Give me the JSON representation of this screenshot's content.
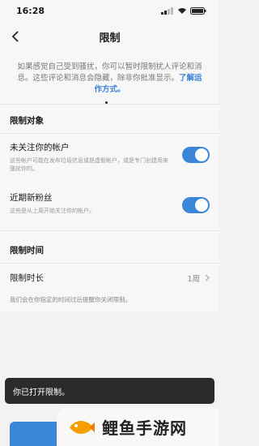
{
  "status_bar": {
    "time": "16:28"
  },
  "nav": {
    "title": "限制"
  },
  "intro": {
    "text": "如果感觉自己受到骚扰，你可以暂时限制扰人评论和消息。这些评论和消息会隐藏，除非你批准显示。",
    "link": "了解运作方式。"
  },
  "restrict_target": {
    "title": "限制对象",
    "items": [
      {
        "title": "未关注你的帐户",
        "desc": "这些帐户可能在发布垃圾信息或是虚假帐户，或是专门创建用来骚扰你的。",
        "enabled": true
      },
      {
        "title": "近期新粉丝",
        "desc": "这些是从上周开始关注你的帐户。",
        "enabled": true
      }
    ]
  },
  "restrict_time": {
    "title": "限制时间",
    "label": "限制时长",
    "value": "1周",
    "note": "我们会在你指定的时间过后提醒你关闭限制。"
  },
  "toast": {
    "text": "你已打开限制。"
  },
  "watermark": {
    "text": "鲤鱼手游网"
  },
  "colors": {
    "accent": "#3a87d8"
  }
}
